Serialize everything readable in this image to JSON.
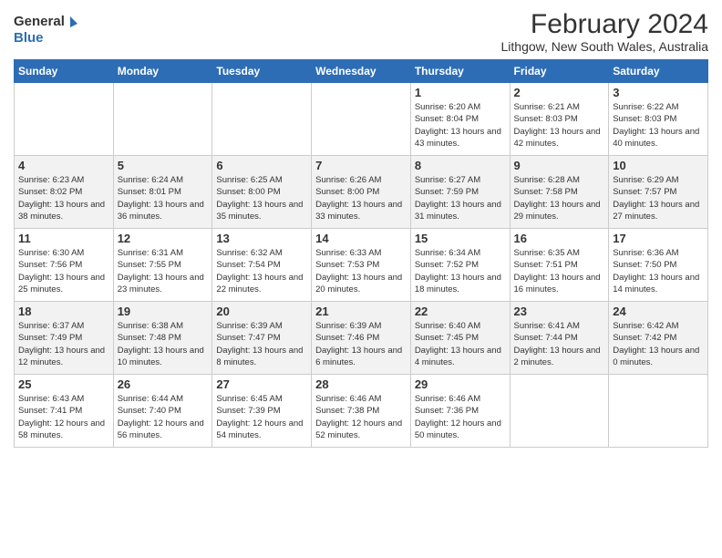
{
  "logo": {
    "line1": "General",
    "line2": "Blue"
  },
  "title": "February 2024",
  "subtitle": "Lithgow, New South Wales, Australia",
  "days_of_week": [
    "Sunday",
    "Monday",
    "Tuesday",
    "Wednesday",
    "Thursday",
    "Friday",
    "Saturday"
  ],
  "weeks": [
    [
      {
        "day": "",
        "info": ""
      },
      {
        "day": "",
        "info": ""
      },
      {
        "day": "",
        "info": ""
      },
      {
        "day": "",
        "info": ""
      },
      {
        "day": "1",
        "info": "Sunrise: 6:20 AM\nSunset: 8:04 PM\nDaylight: 13 hours and 43 minutes."
      },
      {
        "day": "2",
        "info": "Sunrise: 6:21 AM\nSunset: 8:03 PM\nDaylight: 13 hours and 42 minutes."
      },
      {
        "day": "3",
        "info": "Sunrise: 6:22 AM\nSunset: 8:03 PM\nDaylight: 13 hours and 40 minutes."
      }
    ],
    [
      {
        "day": "4",
        "info": "Sunrise: 6:23 AM\nSunset: 8:02 PM\nDaylight: 13 hours and 38 minutes."
      },
      {
        "day": "5",
        "info": "Sunrise: 6:24 AM\nSunset: 8:01 PM\nDaylight: 13 hours and 36 minutes."
      },
      {
        "day": "6",
        "info": "Sunrise: 6:25 AM\nSunset: 8:00 PM\nDaylight: 13 hours and 35 minutes."
      },
      {
        "day": "7",
        "info": "Sunrise: 6:26 AM\nSunset: 8:00 PM\nDaylight: 13 hours and 33 minutes."
      },
      {
        "day": "8",
        "info": "Sunrise: 6:27 AM\nSunset: 7:59 PM\nDaylight: 13 hours and 31 minutes."
      },
      {
        "day": "9",
        "info": "Sunrise: 6:28 AM\nSunset: 7:58 PM\nDaylight: 13 hours and 29 minutes."
      },
      {
        "day": "10",
        "info": "Sunrise: 6:29 AM\nSunset: 7:57 PM\nDaylight: 13 hours and 27 minutes."
      }
    ],
    [
      {
        "day": "11",
        "info": "Sunrise: 6:30 AM\nSunset: 7:56 PM\nDaylight: 13 hours and 25 minutes."
      },
      {
        "day": "12",
        "info": "Sunrise: 6:31 AM\nSunset: 7:55 PM\nDaylight: 13 hours and 23 minutes."
      },
      {
        "day": "13",
        "info": "Sunrise: 6:32 AM\nSunset: 7:54 PM\nDaylight: 13 hours and 22 minutes."
      },
      {
        "day": "14",
        "info": "Sunrise: 6:33 AM\nSunset: 7:53 PM\nDaylight: 13 hours and 20 minutes."
      },
      {
        "day": "15",
        "info": "Sunrise: 6:34 AM\nSunset: 7:52 PM\nDaylight: 13 hours and 18 minutes."
      },
      {
        "day": "16",
        "info": "Sunrise: 6:35 AM\nSunset: 7:51 PM\nDaylight: 13 hours and 16 minutes."
      },
      {
        "day": "17",
        "info": "Sunrise: 6:36 AM\nSunset: 7:50 PM\nDaylight: 13 hours and 14 minutes."
      }
    ],
    [
      {
        "day": "18",
        "info": "Sunrise: 6:37 AM\nSunset: 7:49 PM\nDaylight: 13 hours and 12 minutes."
      },
      {
        "day": "19",
        "info": "Sunrise: 6:38 AM\nSunset: 7:48 PM\nDaylight: 13 hours and 10 minutes."
      },
      {
        "day": "20",
        "info": "Sunrise: 6:39 AM\nSunset: 7:47 PM\nDaylight: 13 hours and 8 minutes."
      },
      {
        "day": "21",
        "info": "Sunrise: 6:39 AM\nSunset: 7:46 PM\nDaylight: 13 hours and 6 minutes."
      },
      {
        "day": "22",
        "info": "Sunrise: 6:40 AM\nSunset: 7:45 PM\nDaylight: 13 hours and 4 minutes."
      },
      {
        "day": "23",
        "info": "Sunrise: 6:41 AM\nSunset: 7:44 PM\nDaylight: 13 hours and 2 minutes."
      },
      {
        "day": "24",
        "info": "Sunrise: 6:42 AM\nSunset: 7:42 PM\nDaylight: 13 hours and 0 minutes."
      }
    ],
    [
      {
        "day": "25",
        "info": "Sunrise: 6:43 AM\nSunset: 7:41 PM\nDaylight: 12 hours and 58 minutes."
      },
      {
        "day": "26",
        "info": "Sunrise: 6:44 AM\nSunset: 7:40 PM\nDaylight: 12 hours and 56 minutes."
      },
      {
        "day": "27",
        "info": "Sunrise: 6:45 AM\nSunset: 7:39 PM\nDaylight: 12 hours and 54 minutes."
      },
      {
        "day": "28",
        "info": "Sunrise: 6:46 AM\nSunset: 7:38 PM\nDaylight: 12 hours and 52 minutes."
      },
      {
        "day": "29",
        "info": "Sunrise: 6:46 AM\nSunset: 7:36 PM\nDaylight: 12 hours and 50 minutes."
      },
      {
        "day": "",
        "info": ""
      },
      {
        "day": "",
        "info": ""
      }
    ]
  ]
}
